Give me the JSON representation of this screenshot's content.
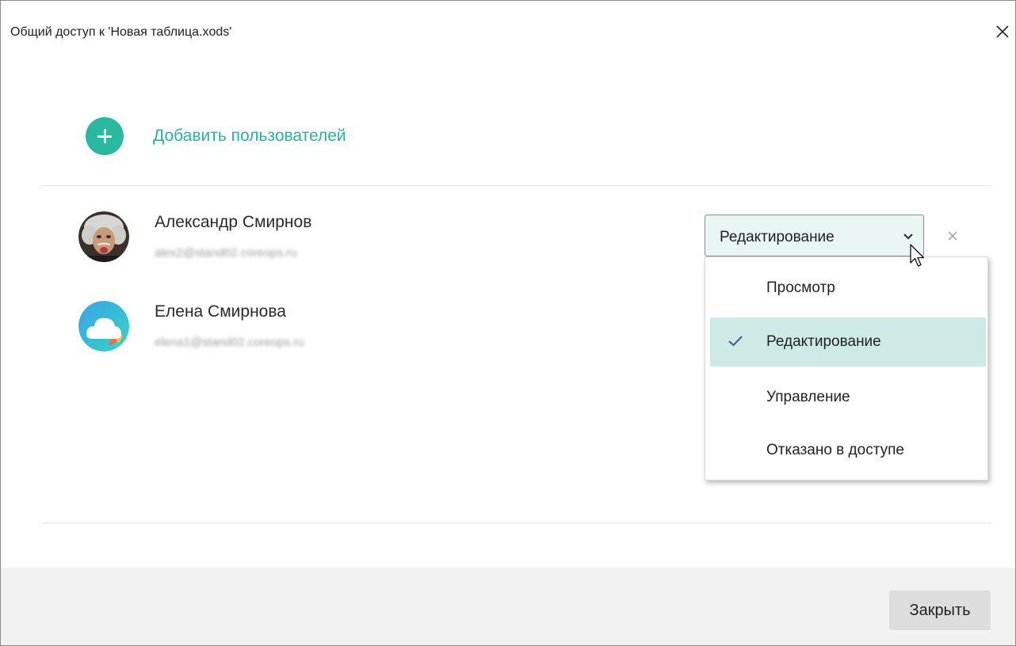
{
  "window": {
    "title": "Общий доступ к 'Новая таблица.xods'"
  },
  "add_users": {
    "label": "Добавить пользователей",
    "accent_color": "#2bb8a0"
  },
  "users": [
    {
      "name": "Александр Смирнов",
      "email": "alex2@stand02.coreops.ru",
      "avatar": "photo-avatar",
      "access": "Редактирование"
    },
    {
      "name": "Елена Смирнова",
      "email": "elena1@stand02.coreops.ru",
      "avatar": "cloud-logo-avatar"
    }
  ],
  "access_dropdown": {
    "selected": "Редактирование",
    "options": [
      {
        "label": "Просмотр",
        "selected": false
      },
      {
        "label": "Редактирование",
        "selected": true
      },
      {
        "label": "Управление",
        "selected": false
      },
      {
        "label": "Отказано в доступе",
        "selected": false
      }
    ]
  },
  "footer": {
    "close_label": "Закрыть"
  }
}
